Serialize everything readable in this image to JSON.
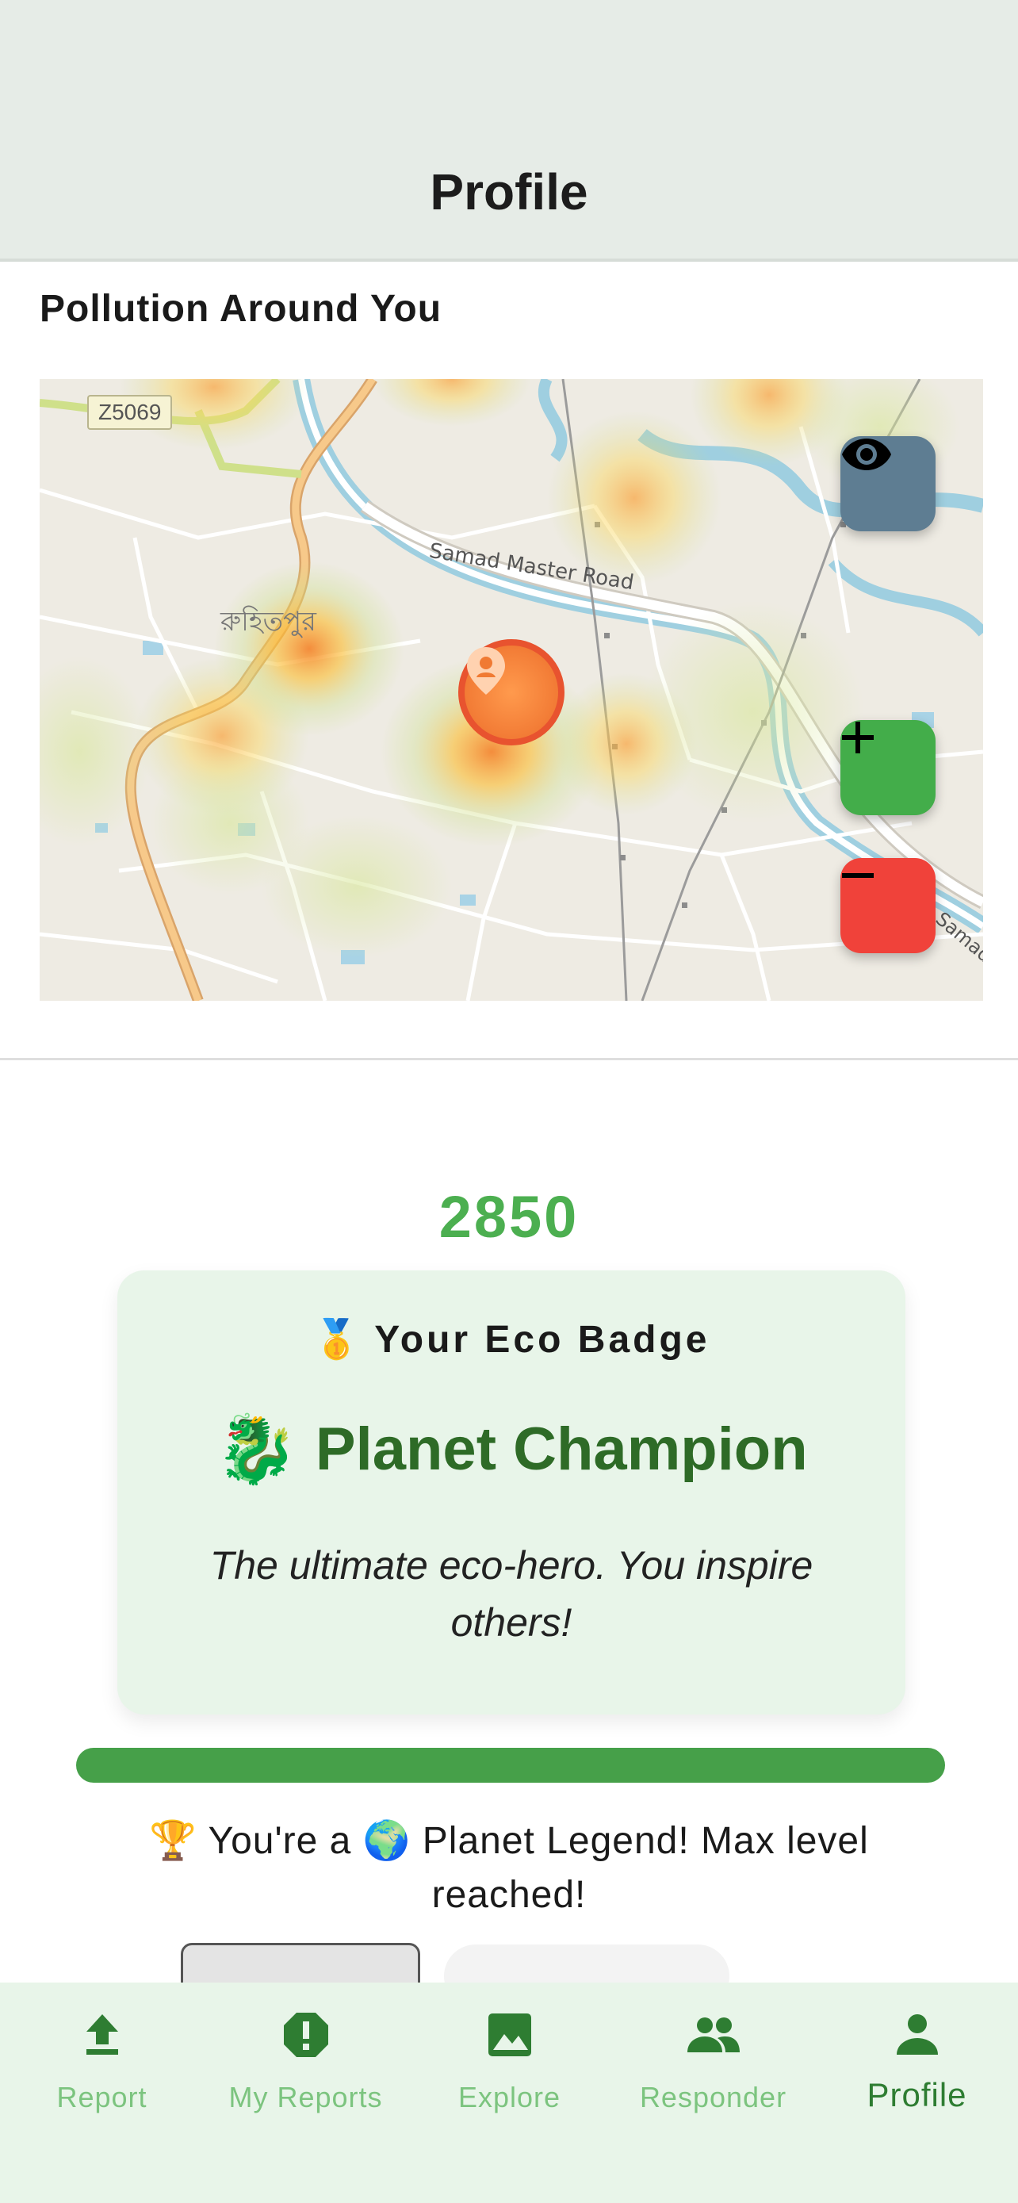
{
  "header": {
    "title": "Profile"
  },
  "map_section": {
    "title": "Pollution Around You",
    "road_badge": "Z5069",
    "road_label": "Samad Master Road",
    "place_label": "রুহিতপুর",
    "edge_label": "Samad",
    "controls": {
      "visibility_icon": "eye-icon",
      "zoom_in_icon": "plus-icon",
      "zoom_out_icon": "minus-icon"
    }
  },
  "profile": {
    "points": "2850",
    "badge": {
      "medal": "🥇",
      "heading": "Your Eco Badge",
      "emoji": "🐉",
      "name": "Planet Champion",
      "description": "The ultimate eco-hero. You inspire others!"
    },
    "progress_fraction": 1.0,
    "level_message": "🏆  You're a 🌍  Planet Legend! Max level reached!"
  },
  "tabs": [
    {
      "label": "Report",
      "icon": "upload-icon",
      "active": false
    },
    {
      "label": "My Reports",
      "icon": "alert-icon",
      "active": false
    },
    {
      "label": "Explore",
      "icon": "image-icon",
      "active": false
    },
    {
      "label": "Responder",
      "icon": "people-icon",
      "active": false
    },
    {
      "label": "Profile",
      "icon": "person-icon",
      "active": true
    }
  ],
  "colors": {
    "accent": "#4caf50",
    "accent_dark": "#2e7d32",
    "card_bg": "#e8f5e9",
    "header_bg": "#e6ece7",
    "danger": "#f0423a",
    "neutral_fab": "#5e7d92"
  }
}
